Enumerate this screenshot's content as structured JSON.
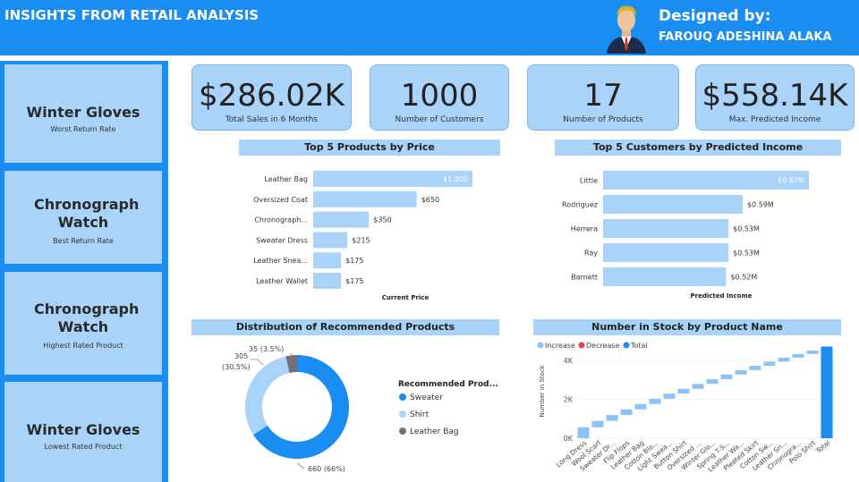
{
  "header": {
    "title": "INSIGHTS FROM RETAIL ANALYSIS",
    "designed_by_label": "Designed by:",
    "designer_name": "FAROUQ ADESHINA ALAKA"
  },
  "sidebar": {
    "cards": [
      {
        "title": "Winter Gloves",
        "subtitle": "Worst Return Rate"
      },
      {
        "title": "Chronograph Watch",
        "subtitle": "Best Return Rate"
      },
      {
        "title": "Chronograph Watch",
        "subtitle": "Highest Rated Product"
      },
      {
        "title": "Winter Gloves",
        "subtitle": "Lowest Rated Product"
      }
    ]
  },
  "kpis": [
    {
      "value": "$286.02K",
      "label": "Total Sales in 6 Months"
    },
    {
      "value": "1000",
      "label": "Number of Customers"
    },
    {
      "value": "17",
      "label": "Number of Products"
    },
    {
      "value": "$558.14K",
      "label": "Max. Predicted Income"
    }
  ],
  "colors": {
    "accent": "#1a8df2",
    "card": "#a9d3f8",
    "bar": "#a9d3f8",
    "shirt": "#8cc3f7",
    "leather": "#707070",
    "decrease": "#e0404f"
  },
  "chart_data": [
    {
      "type": "bar",
      "orientation": "horizontal",
      "title": "Top 5 Products by Price",
      "xlabel": "Current Price",
      "categories": [
        "Leather Bag",
        "Oversized Coat",
        "Chronograph...",
        "Sweater Dress",
        "Leather Snea...",
        "Leather Wallet"
      ],
      "values": [
        1000,
        650,
        350,
        215,
        175,
        175
      ],
      "data_labels": [
        "$1,000",
        "$650",
        "$350",
        "$215",
        "$175",
        "$175"
      ],
      "xlim": [
        0,
        1000
      ]
    },
    {
      "type": "bar",
      "orientation": "horizontal",
      "title": "Top 5 Customers by Predicted Income",
      "xlabel": "Predicted Income",
      "categories": [
        "Little",
        "Rodriguez",
        "Herrera",
        "Ray",
        "Barnett"
      ],
      "values": [
        0.87,
        0.59,
        0.53,
        0.53,
        0.52
      ],
      "data_labels": [
        "$0.87M",
        "$0.59M",
        "$0.53M",
        "$0.53M",
        "$0.52M"
      ],
      "xlim": [
        0,
        0.87
      ]
    },
    {
      "type": "pie",
      "donut": true,
      "title": "Distribution of Recommended Products",
      "legend_title": "Recommended Prod...",
      "legend_position": "right",
      "slices": [
        {
          "label": "Sweater",
          "value": 660,
          "data_label": "660 (66%)",
          "color": "#1a8df2"
        },
        {
          "label": "Shirt",
          "value": 305,
          "data_label": "305 (30.5%)",
          "color": "#a9d3f8"
        },
        {
          "label": "Leather Bag",
          "value": 35,
          "data_label": "35 (3.5%)",
          "color": "#707070"
        }
      ]
    },
    {
      "type": "waterfall",
      "title": "Number in Stock by Product Name",
      "ylabel": "Number in Stock",
      "legend": [
        "Increase",
        "Decrease",
        "Total"
      ],
      "legend_position": "top-left",
      "y_ticks": [
        "4K",
        "2K",
        "0K"
      ],
      "ylim": [
        0,
        4000
      ],
      "categories": [
        "Long Dress",
        "Wool Scarf",
        "Sweater Dr...",
        "Flip Flops",
        "Leather Bag",
        "Cotton Blo...",
        "Light Swea...",
        "Button Shirt",
        "Oversized ...",
        "Winter Glo...",
        "Spring T-S...",
        "Leather Wa...",
        "Pleated Skirt",
        "Cotton Sw...",
        "Leather Sn...",
        "Chronogra...",
        "Polo Shirt",
        "Total"
      ],
      "values": [
        560,
        330,
        300,
        290,
        280,
        270,
        260,
        250,
        250,
        240,
        240,
        230,
        220,
        220,
        200,
        190,
        180,
        4710
      ]
    }
  ]
}
